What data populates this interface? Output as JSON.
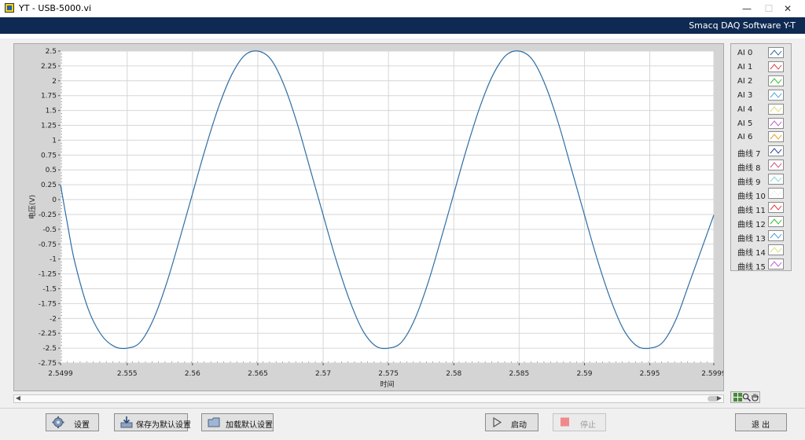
{
  "window": {
    "title": "YT - USB-5000.vi",
    "minimize_glyph": "—",
    "maximize_glyph": "☐",
    "close_glyph": "✕"
  },
  "banner": {
    "text": "Smacq DAQ Software Y-T"
  },
  "graph": {
    "xlabel": "时间",
    "ylabel": "电压(V)"
  },
  "chart_data": {
    "type": "line",
    "xlabel": "时间",
    "ylabel": "电压(V)",
    "xlim": [
      2.5499,
      2.5999
    ],
    "ylim": [
      -2.75,
      2.5
    ],
    "x_ticks": [
      2.5499,
      2.555,
      2.56,
      2.565,
      2.57,
      2.575,
      2.58,
      2.585,
      2.59,
      2.595,
      2.5999
    ],
    "x_tick_labels": [
      "2.5499",
      "2.555",
      "2.56",
      "2.565",
      "2.57",
      "2.575",
      "2.58",
      "2.585",
      "2.59",
      "2.595",
      "2.5999"
    ],
    "y_ticks": [
      2.5,
      2.25,
      2,
      1.75,
      1.5,
      1.25,
      1,
      0.75,
      0.5,
      0.25,
      0,
      -0.25,
      -0.5,
      -0.75,
      -1,
      -1.25,
      -1.5,
      -1.75,
      -2,
      -2.25,
      -2.5,
      -2.75
    ],
    "y_tick_labels": [
      "2.5",
      "2.25",
      "2",
      "1.75",
      "1.5",
      "1.25",
      "1",
      "0.75",
      "0.5",
      "0.25",
      "0",
      "-0.25",
      "-0.5",
      "-0.75",
      "-1",
      "-1.25",
      "-1.5",
      "-1.75",
      "-2",
      "-2.25",
      "-2.5",
      "-2.75"
    ],
    "grid": true,
    "series": [
      {
        "name": "AI 0",
        "color": "#2e6da4",
        "x": [
          2.5499,
          2.5505,
          2.551,
          2.552,
          2.553,
          2.554,
          2.555,
          2.556,
          2.557,
          2.558,
          2.559,
          2.56,
          2.561,
          2.562,
          2.563,
          2.564,
          2.565,
          2.566,
          2.567,
          2.568,
          2.569,
          2.57,
          2.571,
          2.572,
          2.573,
          2.574,
          2.575,
          2.576,
          2.577,
          2.578,
          2.579,
          2.58,
          2.581,
          2.582,
          2.583,
          2.584,
          2.585,
          2.586,
          2.587,
          2.588,
          2.589,
          2.59,
          2.591,
          2.592,
          2.593,
          2.594,
          2.595,
          2.596,
          2.597,
          2.598,
          2.5999
        ],
        "y": [
          0.25,
          -0.5,
          -1.06,
          -1.83,
          -2.27,
          -2.47,
          -2.5,
          -2.4,
          -2.02,
          -1.42,
          -0.68,
          0.1,
          0.87,
          1.56,
          2.1,
          2.43,
          2.5,
          2.36,
          1.93,
          1.29,
          0.52,
          -0.26,
          -1.02,
          -1.68,
          -2.19,
          -2.46,
          -2.5,
          -2.4,
          -2.02,
          -1.42,
          -0.68,
          0.1,
          0.87,
          1.56,
          2.1,
          2.43,
          2.5,
          2.36,
          1.93,
          1.29,
          0.52,
          -0.26,
          -1.02,
          -1.68,
          -2.19,
          -2.46,
          -2.5,
          -2.4,
          -2.02,
          -1.42,
          -0.26
        ]
      }
    ]
  },
  "legend": [
    {
      "name": "AI 0",
      "color": "#2e6da4"
    },
    {
      "name": "AI 1",
      "color": "#e0404a"
    },
    {
      "name": "AI 2",
      "color": "#2fc02f"
    },
    {
      "name": "AI 3",
      "color": "#49a8e0"
    },
    {
      "name": "AI 4",
      "color": "#d8e070"
    },
    {
      "name": "AI 5",
      "color": "#c35ad8"
    },
    {
      "name": "AI 6",
      "color": "#e8a020"
    },
    {
      "name": "曲线 7",
      "color": "#2b3fa8"
    },
    {
      "name": "曲线 8",
      "color": "#e04a80"
    },
    {
      "name": "曲线 9",
      "color": "#7fd8d8"
    },
    {
      "name": "曲线 10",
      "color": "#f0f0f0"
    },
    {
      "name": "曲线 11",
      "color": "#e03a3a"
    },
    {
      "name": "曲线 12",
      "color": "#2fbf2f"
    },
    {
      "name": "曲线 13",
      "color": "#4aa0e0"
    },
    {
      "name": "曲线 14",
      "color": "#d8e07a"
    },
    {
      "name": "曲线 15",
      "color": "#c35ad8"
    }
  ],
  "palette": {
    "icons": [
      "crosshair-icon",
      "zoom-icon",
      "pan-hand-icon"
    ]
  },
  "buttons": {
    "settings": "设置",
    "save_default": "保存为默认设置",
    "load_default": "加载默认设置",
    "start": "启动",
    "stop": "停止",
    "exit": "退 出"
  },
  "scroll": {
    "left_glyph": "◀",
    "right_glyph": "▶"
  }
}
